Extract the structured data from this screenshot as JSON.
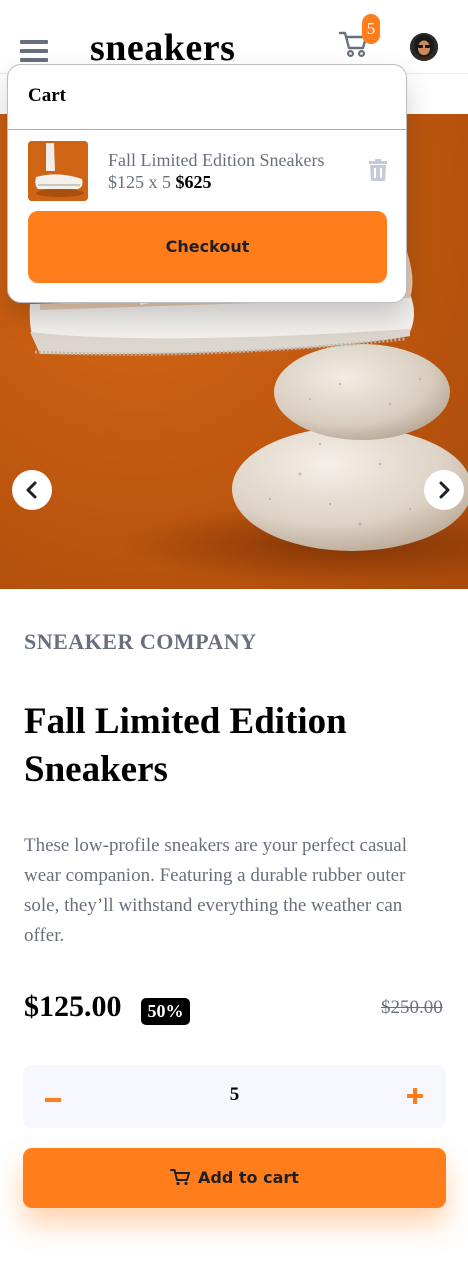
{
  "header": {
    "brand": "sneakers",
    "cart_count": "5"
  },
  "cart": {
    "title": "Cart",
    "item": {
      "name": "Fall Limited Edition Sneakers",
      "unit_price": "$125 x 5",
      "total": "$625"
    },
    "checkout_label": "Checkout"
  },
  "product": {
    "company": "SNEAKER COMPANY",
    "title": "Fall Limited Edition Sneakers",
    "description": "These low-profile sneakers are your perfect casual wear companion. Featuring a durable rubber outer sole, they’ll withstand everything the weather can offer.",
    "price": "$125.00",
    "discount": "50%",
    "original_price": "$250.00"
  },
  "quantity": {
    "value": "5"
  },
  "add_to_cart_label": "Add to cart",
  "colors": {
    "accent": "#ff7e1b",
    "text_dark": "#1d2026",
    "text_muted": "#69707d",
    "stepper_bg": "#f6f8fd"
  },
  "icons": [
    "menu-icon",
    "cart-icon",
    "avatar",
    "chevron-left-icon",
    "chevron-right-icon",
    "trash-icon",
    "minus-icon",
    "plus-icon"
  ]
}
